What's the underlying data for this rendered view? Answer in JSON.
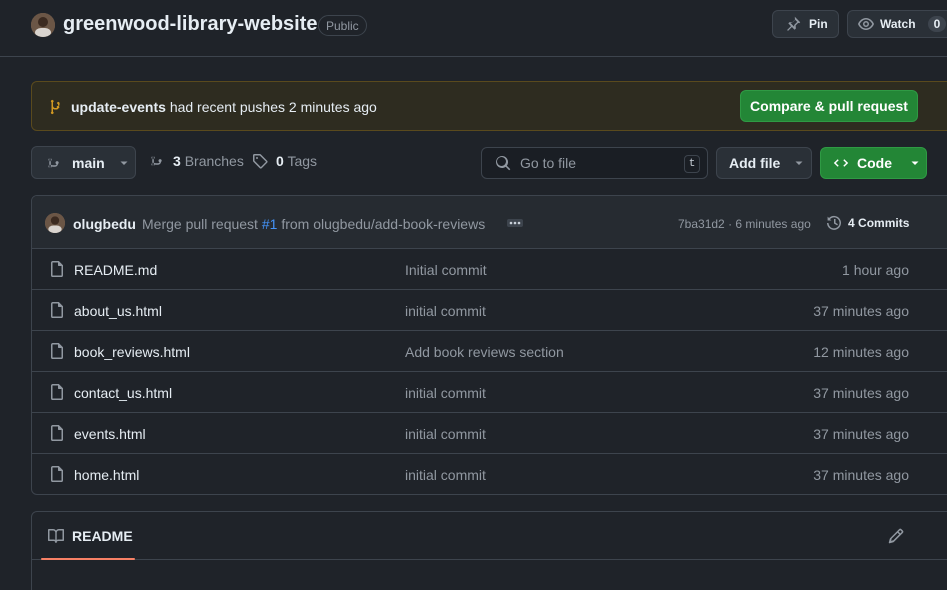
{
  "repo": {
    "name": "greenwood-library-website",
    "visibility": "Public",
    "pin_label": "Pin",
    "watch_label": "Watch",
    "watch_count": "0"
  },
  "banner": {
    "branch": "update-events",
    "message": "had recent pushes 2 minutes ago",
    "button_label": "Compare & pull request"
  },
  "nav": {
    "branch": "main",
    "branches_count": "3",
    "branches_label": "Branches",
    "tags_count": "0",
    "tags_label": "Tags",
    "goto_placeholder": "Go to file",
    "goto_shortcut": "t",
    "add_file_label": "Add file",
    "code_label": "Code"
  },
  "commit": {
    "author": "olugbedu",
    "message_prefix": "Merge pull request",
    "pr_link": "#1",
    "message_suffix": "from olugbedu/add-book-reviews",
    "hash": "7ba31d2",
    "separator": "·",
    "time": "6 minutes ago",
    "commits_count": "4",
    "commits_label": "Commits"
  },
  "files": [
    {
      "name": "README.md",
      "message": "Initial commit",
      "time": "1 hour ago"
    },
    {
      "name": "about_us.html",
      "message": "initial commit",
      "time": "37 minutes ago"
    },
    {
      "name": "book_reviews.html",
      "message": "Add book reviews section",
      "time": "12 minutes ago"
    },
    {
      "name": "contact_us.html",
      "message": "initial commit",
      "time": "37 minutes ago"
    },
    {
      "name": "events.html",
      "message": "initial commit",
      "time": "37 minutes ago"
    },
    {
      "name": "home.html",
      "message": "initial commit",
      "time": "37 minutes ago"
    }
  ],
  "readme": {
    "tab_label": "README"
  },
  "colors": {
    "accent_green": "#238636",
    "link_blue": "#4493f8",
    "tab_underline": "#f78166",
    "banner_bg": "#2e2c20"
  },
  "icons": [
    "owner-avatar",
    "pin-icon",
    "eye-icon",
    "git-branch-icon",
    "tag-icon",
    "search-icon",
    "code-icon",
    "chevron-down-icon",
    "ellipsis-icon",
    "history-icon",
    "file-icon",
    "book-icon",
    "pencil-icon"
  ]
}
